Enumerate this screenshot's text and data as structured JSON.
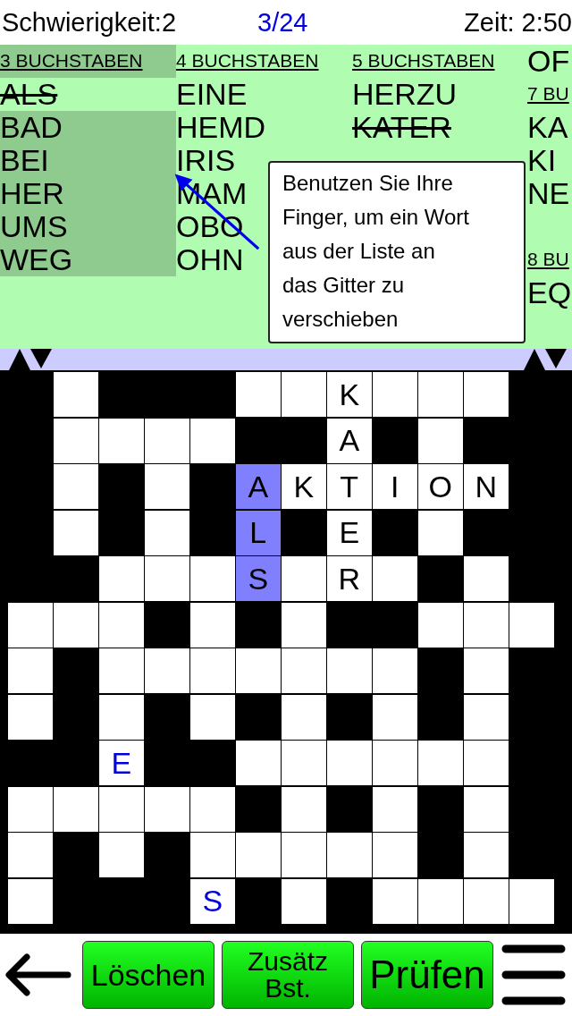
{
  "status": {
    "difficulty": "Schwierigkeit:2",
    "progress": "3/24",
    "time": "Zeit: 2:50"
  },
  "word_list": {
    "columns": [
      {
        "selected": true,
        "items": [
          {
            "kind": "header",
            "text": "3 BUCHSTABEN"
          },
          {
            "kind": "word",
            "text": "ALS",
            "done": true
          },
          {
            "kind": "word",
            "text": "BAD",
            "done": false
          },
          {
            "kind": "word",
            "text": "BEI",
            "done": false
          },
          {
            "kind": "word",
            "text": "HER",
            "done": false
          },
          {
            "kind": "word",
            "text": "UMS",
            "done": false
          },
          {
            "kind": "word",
            "text": "WEG",
            "done": false
          }
        ]
      },
      {
        "selected": false,
        "items": [
          {
            "kind": "header",
            "text": "4 BUCHSTABEN"
          },
          {
            "kind": "word",
            "text": "EINE",
            "done": false
          },
          {
            "kind": "word",
            "text": "HEMD",
            "done": false
          },
          {
            "kind": "word",
            "text": "IRIS",
            "done": false
          },
          {
            "kind": "word",
            "text": "MAM",
            "done": false
          },
          {
            "kind": "word",
            "text": "OBO",
            "done": false
          },
          {
            "kind": "word",
            "text": "OHN",
            "done": false
          }
        ]
      },
      {
        "selected": false,
        "items": [
          {
            "kind": "header",
            "text": "5 BUCHSTABEN"
          },
          {
            "kind": "word",
            "text": "HERZU",
            "done": false
          },
          {
            "kind": "word",
            "text": "KATER",
            "done": true
          }
        ]
      },
      {
        "selected": false,
        "items": [
          {
            "kind": "word",
            "text": "OF",
            "done": false
          },
          {
            "kind": "header",
            "text": "7 BU"
          },
          {
            "kind": "word",
            "text": "KA",
            "done": false
          },
          {
            "kind": "word",
            "text": "KI",
            "done": false
          },
          {
            "kind": "word",
            "text": "NE",
            "done": false
          },
          {
            "kind": "gap"
          },
          {
            "kind": "header",
            "text": "8 BU"
          },
          {
            "kind": "word",
            "text": "EQ",
            "done": false
          }
        ]
      }
    ]
  },
  "tooltip": {
    "text": "Benutzen Sie Ihre\nFinger, um ein Wort\naus der Liste an\ndas Gitter zu\nverschieben"
  },
  "grid": {
    "rows": [
      [
        {
          "kind": "block"
        },
        {
          "kind": "empty"
        },
        {
          "kind": "block"
        },
        {
          "kind": "block"
        },
        {
          "kind": "block"
        },
        {
          "kind": "empty"
        },
        {
          "kind": "empty"
        },
        {
          "kind": "letter",
          "letter": "K"
        },
        {
          "kind": "empty"
        },
        {
          "kind": "empty"
        },
        {
          "kind": "empty"
        },
        {
          "kind": "block"
        }
      ],
      [
        {
          "kind": "block"
        },
        {
          "kind": "empty"
        },
        {
          "kind": "empty"
        },
        {
          "kind": "empty"
        },
        {
          "kind": "empty"
        },
        {
          "kind": "block"
        },
        {
          "kind": "block"
        },
        {
          "kind": "letter",
          "letter": "A"
        },
        {
          "kind": "block"
        },
        {
          "kind": "empty"
        },
        {
          "kind": "block"
        },
        {
          "kind": "block"
        }
      ],
      [
        {
          "kind": "block"
        },
        {
          "kind": "empty"
        },
        {
          "kind": "block"
        },
        {
          "kind": "empty"
        },
        {
          "kind": "block"
        },
        {
          "kind": "selected",
          "letter": "A"
        },
        {
          "kind": "letter",
          "letter": "K"
        },
        {
          "kind": "letter",
          "letter": "T"
        },
        {
          "kind": "letter",
          "letter": "I"
        },
        {
          "kind": "letter",
          "letter": "O"
        },
        {
          "kind": "letter",
          "letter": "N"
        },
        {
          "kind": "block"
        }
      ],
      [
        {
          "kind": "block"
        },
        {
          "kind": "empty"
        },
        {
          "kind": "block"
        },
        {
          "kind": "empty"
        },
        {
          "kind": "block"
        },
        {
          "kind": "selected",
          "letter": "L"
        },
        {
          "kind": "block"
        },
        {
          "kind": "letter",
          "letter": "E"
        },
        {
          "kind": "block"
        },
        {
          "kind": "empty"
        },
        {
          "kind": "block"
        },
        {
          "kind": "block"
        }
      ],
      [
        {
          "kind": "block"
        },
        {
          "kind": "block"
        },
        {
          "kind": "empty"
        },
        {
          "kind": "empty"
        },
        {
          "kind": "empty"
        },
        {
          "kind": "selected",
          "letter": "S"
        },
        {
          "kind": "empty"
        },
        {
          "kind": "letter",
          "letter": "R"
        },
        {
          "kind": "empty"
        },
        {
          "kind": "block"
        },
        {
          "kind": "empty"
        },
        {
          "kind": "block"
        }
      ],
      [
        {
          "kind": "empty"
        },
        {
          "kind": "empty"
        },
        {
          "kind": "empty"
        },
        {
          "kind": "block"
        },
        {
          "kind": "empty"
        },
        {
          "kind": "block"
        },
        {
          "kind": "empty"
        },
        {
          "kind": "block"
        },
        {
          "kind": "block"
        },
        {
          "kind": "empty"
        },
        {
          "kind": "empty"
        },
        {
          "kind": "empty"
        }
      ],
      [
        {
          "kind": "empty"
        },
        {
          "kind": "block"
        },
        {
          "kind": "empty"
        },
        {
          "kind": "empty"
        },
        {
          "kind": "empty"
        },
        {
          "kind": "empty"
        },
        {
          "kind": "empty"
        },
        {
          "kind": "empty"
        },
        {
          "kind": "empty"
        },
        {
          "kind": "block"
        },
        {
          "kind": "empty"
        },
        {
          "kind": "block"
        }
      ],
      [
        {
          "kind": "empty"
        },
        {
          "kind": "block"
        },
        {
          "kind": "empty"
        },
        {
          "kind": "block"
        },
        {
          "kind": "empty"
        },
        {
          "kind": "block"
        },
        {
          "kind": "empty"
        },
        {
          "kind": "block"
        },
        {
          "kind": "empty"
        },
        {
          "kind": "block"
        },
        {
          "kind": "empty"
        },
        {
          "kind": "block"
        }
      ],
      [
        {
          "kind": "block"
        },
        {
          "kind": "block"
        },
        {
          "kind": "hint",
          "letter": "E"
        },
        {
          "kind": "block"
        },
        {
          "kind": "block"
        },
        {
          "kind": "empty"
        },
        {
          "kind": "empty"
        },
        {
          "kind": "empty"
        },
        {
          "kind": "empty"
        },
        {
          "kind": "empty"
        },
        {
          "kind": "empty"
        },
        {
          "kind": "block"
        }
      ],
      [
        {
          "kind": "empty"
        },
        {
          "kind": "empty"
        },
        {
          "kind": "empty"
        },
        {
          "kind": "empty"
        },
        {
          "kind": "empty"
        },
        {
          "kind": "block"
        },
        {
          "kind": "empty"
        },
        {
          "kind": "block"
        },
        {
          "kind": "empty"
        },
        {
          "kind": "block"
        },
        {
          "kind": "empty"
        },
        {
          "kind": "block"
        }
      ],
      [
        {
          "kind": "empty"
        },
        {
          "kind": "block"
        },
        {
          "kind": "empty"
        },
        {
          "kind": "block"
        },
        {
          "kind": "empty"
        },
        {
          "kind": "empty"
        },
        {
          "kind": "empty"
        },
        {
          "kind": "empty"
        },
        {
          "kind": "empty"
        },
        {
          "kind": "block"
        },
        {
          "kind": "empty"
        },
        {
          "kind": "block"
        }
      ],
      [
        {
          "kind": "empty"
        },
        {
          "kind": "block"
        },
        {
          "kind": "block"
        },
        {
          "kind": "block"
        },
        {
          "kind": "hint",
          "letter": "S"
        },
        {
          "kind": "block"
        },
        {
          "kind": "empty"
        },
        {
          "kind": "block"
        },
        {
          "kind": "empty"
        },
        {
          "kind": "empty"
        },
        {
          "kind": "empty"
        },
        {
          "kind": "empty"
        }
      ]
    ]
  },
  "toolbar": {
    "buttons": [
      "Löschen",
      "Zusätz Bst.",
      "Prüfen"
    ]
  }
}
